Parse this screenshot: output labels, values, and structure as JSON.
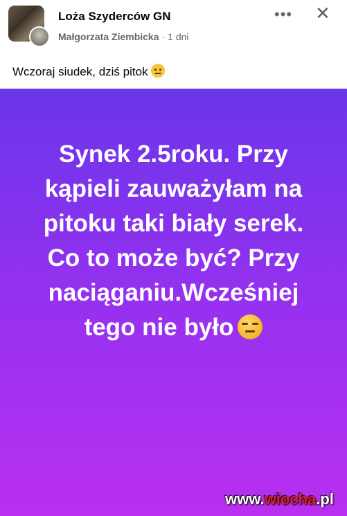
{
  "header": {
    "group_name": "Loża Szyderców GN",
    "author": "Małgorzata Ziembicka",
    "separator": "·",
    "time": "1 dni",
    "more_label": "•••",
    "close_label": "✕"
  },
  "caption": "Wczoraj siudek, dziś pitok",
  "post": {
    "text": "Synek 2.5roku. Przy\nkąpieli zauważyłam na\npitoku taki biały serek.\nCo to może być? Przy\nnaciąganiu.Wcześniej\ntego nie było",
    "background_start": "#6a35ea",
    "background_end": "#b92ff0"
  },
  "watermark": {
    "prefix": "www.",
    "brand": "wiocha",
    "suffix": ".pl"
  },
  "icons": [
    "thinking-face-emoji",
    "expressionless-face-emoji",
    "more-icon",
    "close-icon"
  ]
}
